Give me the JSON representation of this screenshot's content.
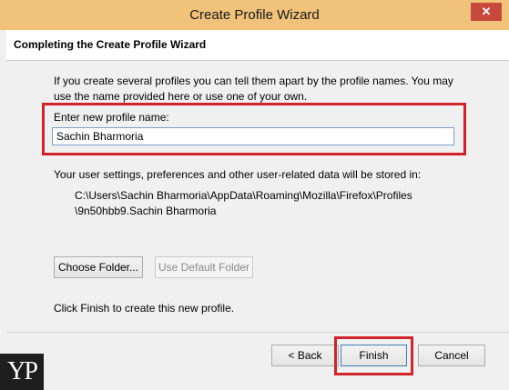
{
  "window": {
    "title": "Create Profile Wizard",
    "close_glyph": "✕"
  },
  "header": {
    "title": "Completing the Create Profile Wizard"
  },
  "main": {
    "description": "If you create several profiles you can tell them apart by the profile names. You may use the name provided here or use one of your own.",
    "name_label": "Enter new profile name:",
    "name_value": "Sachin Bharmoria",
    "storage_text": "Your user settings, preferences and other user-related data will be stored in:",
    "path_line1": "C:\\Users\\Sachin Bharmoria\\AppData\\Roaming\\Mozilla\\Firefox\\Profiles",
    "path_line2": "\\9n50hbb9.Sachin Bharmoria",
    "choose_folder_label": "Choose Folder...",
    "use_default_label": "Use Default Folder",
    "finish_hint": "Click Finish to create this new profile."
  },
  "footer": {
    "back_label": "< Back",
    "finish_label": "Finish",
    "cancel_label": "Cancel"
  },
  "watermark": {
    "text": "YP"
  },
  "colors": {
    "highlight": "#d2232a",
    "titlebar": "#f0c27a",
    "close": "#c7483d"
  }
}
